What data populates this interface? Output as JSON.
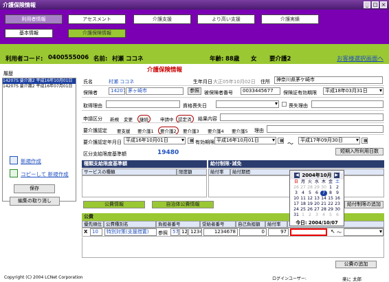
{
  "window": {
    "title": "介護保険情報"
  },
  "nav": {
    "tabs": [
      {
        "label": "利用者情報"
      },
      {
        "label": "アセスメント"
      },
      {
        "label": "介護支援"
      },
      {
        "label": "より高い支援"
      },
      {
        "label": "介護実績"
      }
    ],
    "subtabs": [
      {
        "label": "基本情報"
      },
      {
        "label": "介護保険情報"
      }
    ]
  },
  "userbar": {
    "code_label": "利用者コード:",
    "code": "0400555006",
    "name_label": "名前:",
    "name": "村瀬 ココネ",
    "age_label": "年齢:",
    "age": "88歳",
    "gender": "女",
    "care_level": "要介護2",
    "back_link": "お客様選択画面へ"
  },
  "history": {
    "title": "履歴",
    "items": [
      {
        "text": "14207S 要介護2 平成16年10月01日",
        "selected": true
      },
      {
        "text": "14207S 要介護2 平成16年07月01日",
        "selected": false
      }
    ]
  },
  "left_actions": {
    "new": "新規作成",
    "copy_new": "コピーして 新規作成",
    "save": "保存",
    "cancel": "編集の取り消し"
  },
  "form": {
    "title": "介護保険情報",
    "name_label": "氏名",
    "name_value": "村瀬  ココネ",
    "dob_label": "生年月日",
    "dob_value": "大正05年10月02日",
    "addr_label": "住所",
    "addr_value": "神奈川県茅ケ崎市",
    "insurer_label": "保険者",
    "insurer_code": "142075",
    "insurer_name": "茅ヶ崎市",
    "ref_btn": "参照",
    "insured_no_label": "被保険者番号",
    "insured_no": "0033445677",
    "validity_label": "保険証有効期限",
    "validity": "平成18年03月31日",
    "acq_reason_label": "取得理由",
    "qual_loss_label": "資格喪失日",
    "loss_reason_label": "喪失理由",
    "app_class_label": "申請区分",
    "app_class_opts": [
      "新規",
      "変更",
      "継続"
    ],
    "app_status_opts": [
      "申請中",
      "認定済"
    ],
    "result_label": "結果内容",
    "cert_label": "要介護認定",
    "cert_opts": [
      "要支援",
      "要介護1",
      "要介護2",
      "要介護3",
      "要介護4",
      "要介護5"
    ],
    "reason_label": "理由",
    "cert_date_label": "要介護認定年月日",
    "cert_date": "平成16年10月01日",
    "valid_period_label": "有効期限",
    "valid_from": "平成16年10月01日",
    "tilde": "～",
    "valid_to": "平成17年09月30日",
    "limit_label": "区分支給限度基準額",
    "limit_value": "19480",
    "short_stay_btn": "短期入所利用日数"
  },
  "service_panel": {
    "title": "種類支給限度基準額",
    "col1": "サービスの種類",
    "col2": "限度額"
  },
  "benefit_panel": {
    "title": "給付制限･減免",
    "col1": "給付率",
    "col2": "給付期間"
  },
  "benefit_add_btn": "給付制限の追加",
  "pub_tabs": {
    "public": "公費情報",
    "self": "自治体公費情報"
  },
  "public": {
    "title": "公費",
    "headers": [
      "優先順位",
      "公費種別名",
      "負担者番号",
      "受給者番号",
      "自己負担額",
      "給付率"
    ],
    "row": {
      "del": "X",
      "priority": "10",
      "type": "特別対策(支援措置)",
      "ref": "参照",
      "burden_a": "57",
      "burden_b": "12",
      "burden_c": "1234",
      "recipient": "1234678",
      "copay": "0",
      "rate": "97",
      "tilde": "～"
    }
  },
  "public_add_btn": "公費の追加",
  "calendar": {
    "month": "2004年10月",
    "weekdays": [
      "日",
      "月",
      "火",
      "水",
      "木",
      "金",
      "土"
    ],
    "days": [
      [
        "26",
        "27",
        "28",
        "29",
        "30",
        "1",
        "2"
      ],
      [
        "3",
        "4",
        "5",
        "6",
        "7",
        "8",
        "9"
      ],
      [
        "10",
        "11",
        "12",
        "13",
        "14",
        "15",
        "16"
      ],
      [
        "17",
        "18",
        "19",
        "20",
        "21",
        "22",
        "23"
      ],
      [
        "24",
        "25",
        "26",
        "27",
        "28",
        "29",
        "30"
      ],
      [
        "31",
        "1",
        "2",
        "3",
        "4",
        "5",
        "6"
      ]
    ],
    "today_label": "今日: 2004/10/07"
  },
  "footer": {
    "copyright": "Copyright (C) 2004 LCNet Corporation",
    "login_label": "ログインユーザー:",
    "user": "楽に 太郎"
  },
  "colors": {
    "nav_bg": "#7b00b4",
    "green": "#9ac832",
    "panel_head": "#2b3c6e"
  }
}
